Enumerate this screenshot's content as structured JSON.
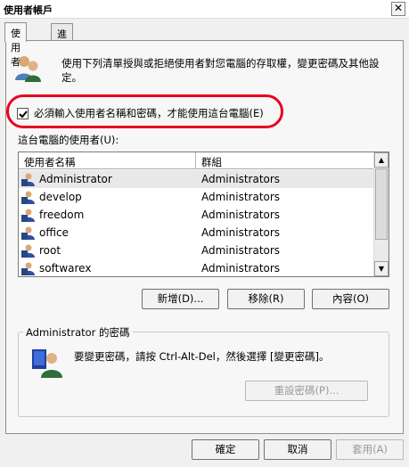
{
  "window": {
    "title": "使用者帳戶",
    "close_glyph": "✕"
  },
  "tabs": [
    {
      "label": "使用者",
      "active": true
    },
    {
      "label": "進階",
      "active": false
    }
  ],
  "intro_text": "使用下列清單授與或拒絕使用者對您電腦的存取權，變更密碼及其他設定。",
  "require_login_checkbox": {
    "label": "必須輸入使用者名稱和密碼，才能使用這台電腦(E)",
    "checked": true
  },
  "users_list": {
    "label": "這台電腦的使用者(U):",
    "columns": [
      "使用者名稱",
      "群組"
    ],
    "rows": [
      {
        "name": "Administrator",
        "group": "Administrators"
      },
      {
        "name": "develop",
        "group": "Administrators"
      },
      {
        "name": "freedom",
        "group": "Administrators"
      },
      {
        "name": "office",
        "group": "Administrators"
      },
      {
        "name": "root",
        "group": "Administrators"
      },
      {
        "name": "softwarex",
        "group": "Administrators"
      }
    ]
  },
  "list_buttons": {
    "add": "新增(D)...",
    "remove": "移除(R)",
    "properties": "內容(O)"
  },
  "password_group": {
    "legend": "Administrator 的密碼",
    "text": "要變更密碼，請按 Ctrl-Alt-Del，然後選擇 [變更密碼]。",
    "reset_button": "重設密碼(P)..."
  },
  "dialog_buttons": {
    "ok": "確定",
    "cancel": "取消",
    "apply": "套用(A)"
  },
  "colors": {
    "highlight_ring": "#e8001c",
    "selected_row": "#e8e8e8"
  }
}
